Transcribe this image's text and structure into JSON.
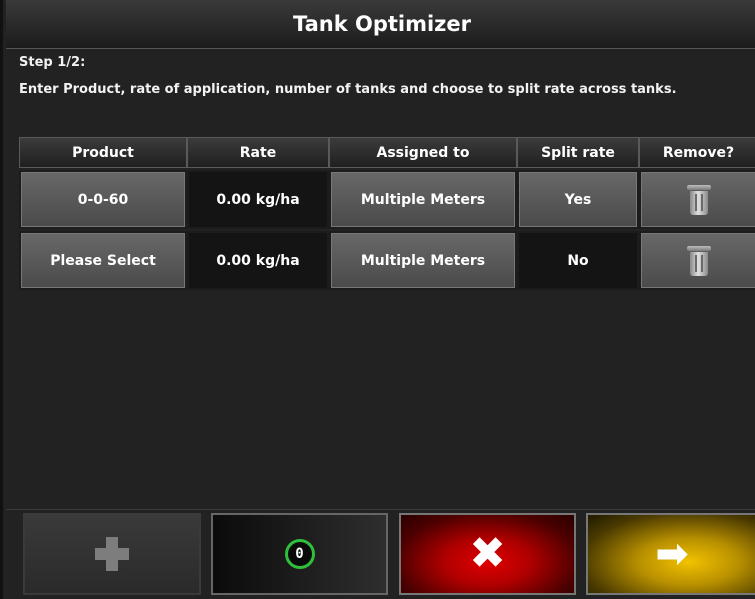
{
  "title": "Tank Optimizer",
  "step": "Step 1/2:",
  "description": "Enter Product, rate of application, number of tanks and choose to split rate across tanks.",
  "table": {
    "headers": [
      "Product",
      "Rate",
      "Assigned to",
      "Split rate",
      "Remove?"
    ],
    "rows": [
      {
        "product": "0-0-60",
        "rate": "0.00 kg/ha",
        "assigned": "Multiple Meters",
        "split": "Yes",
        "remove_icon": "trash-icon"
      },
      {
        "product": "Please Select",
        "rate": "0.00 kg/ha",
        "assigned": "Multiple Meters",
        "split": "No",
        "remove_icon": "trash-icon"
      }
    ]
  },
  "footer": {
    "add_icon": "plus-icon",
    "reset_label": "0",
    "cancel_icon": "x-icon",
    "next_icon": "arrow-right-icon"
  },
  "colors": {
    "cancel": "#c00000",
    "next": "#e0b000",
    "reset_ring": "#2fbf3a"
  }
}
